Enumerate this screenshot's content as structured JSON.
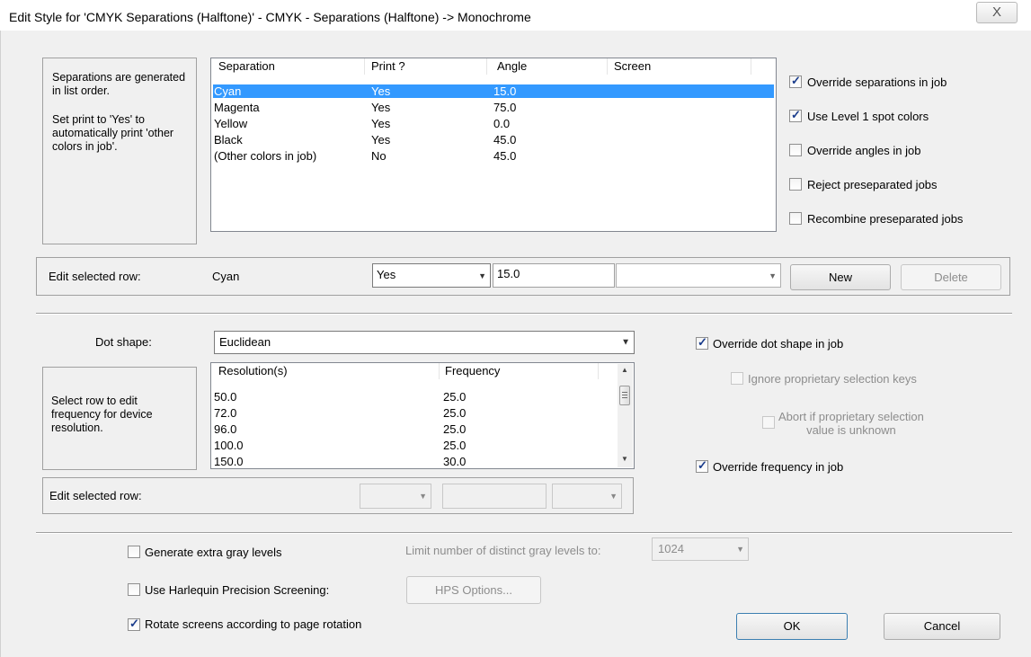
{
  "window": {
    "title": "Edit Style for 'CMYK Separations (Halftone)' - CMYK - Separations (Halftone) -> Monochrome",
    "close_glyph": "X"
  },
  "separations": {
    "info": [
      "Separations are generated in list order.",
      "Set print to 'Yes' to automatically print 'other colors in job'."
    ],
    "columns": [
      "Separation",
      "Print ?",
      "Angle",
      "Screen"
    ],
    "rows": [
      {
        "name": "Cyan",
        "print": "Yes",
        "angle": "15.0",
        "screen": ""
      },
      {
        "name": "Magenta",
        "print": "Yes",
        "angle": "75.0",
        "screen": ""
      },
      {
        "name": "Yellow",
        "print": "Yes",
        "angle": "0.0",
        "screen": ""
      },
      {
        "name": "Black",
        "print": "Yes",
        "angle": "45.0",
        "screen": ""
      },
      {
        "name": "(Other colors in job)",
        "print": "No",
        "angle": "45.0",
        "screen": ""
      }
    ],
    "selected_index": 0,
    "options": [
      {
        "label": "Override separations in job",
        "checked": true
      },
      {
        "label": "Use Level 1 spot colors",
        "checked": true
      },
      {
        "label": "Override angles in job",
        "checked": false
      },
      {
        "label": "Reject preseparated jobs",
        "checked": false
      },
      {
        "label": "Recombine preseparated jobs",
        "checked": false
      }
    ],
    "edit_row": {
      "label": "Edit selected row:",
      "name": "Cyan",
      "print_value": "Yes",
      "angle_value": "15.0",
      "screen_value": "",
      "new_label": "New",
      "delete_label": "Delete"
    }
  },
  "screening": {
    "dot_shape_label": "Dot shape:",
    "dot_shape_value": "Euclidean",
    "override_dot_shape": {
      "label": "Override dot shape in job",
      "checked": true
    },
    "ignore_keys": {
      "label": "Ignore proprietary selection keys",
      "checked": false
    },
    "abort_unknown": {
      "label": "Abort if proprietary selection value is unknown",
      "line1": "Abort if proprietary selection",
      "line2": "value is unknown",
      "checked": false
    },
    "override_frequency": {
      "label": "Override frequency in job",
      "checked": true
    },
    "info": "Select row to edit frequency for device resolution.",
    "columns": [
      "Resolution(s)",
      "Frequency"
    ],
    "rows": [
      {
        "res": "50.0",
        "freq": "25.0"
      },
      {
        "res": "72.0",
        "freq": "25.0"
      },
      {
        "res": "96.0",
        "freq": "25.0"
      },
      {
        "res": "100.0",
        "freq": "25.0"
      },
      {
        "res": "150.0",
        "freq": "30.0"
      }
    ],
    "edit_row_label": "Edit selected row:"
  },
  "bottom": {
    "extra_gray": {
      "label": "Generate extra gray levels",
      "checked": false
    },
    "limit_label": "Limit number of distinct gray levels to:",
    "limit_value": "1024",
    "hps": {
      "label": "Use Harlequin Precision Screening:",
      "checked": false
    },
    "hps_options_label": "HPS Options...",
    "rotate": {
      "label": "Rotate screens according to page rotation",
      "checked": true
    },
    "ok_label": "OK",
    "cancel_label": "Cancel"
  }
}
